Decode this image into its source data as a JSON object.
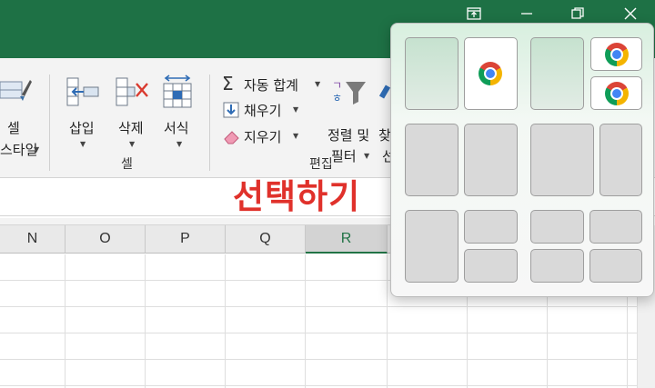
{
  "colors": {
    "title_bar": "#1e7145",
    "accent_green": "#217346",
    "overlay_red": "#e0312b"
  },
  "window_controls": {
    "icons": [
      "restore-ribbon-icon",
      "minimize-icon",
      "maximize-icon",
      "close-icon"
    ]
  },
  "ribbon": {
    "styles_group": {
      "button_label_top": "셀",
      "button_label_bottom": "스타일"
    },
    "cells_group": {
      "label": "셀",
      "buttons": [
        {
          "label": "삽입",
          "icon": "insert-cells-icon"
        },
        {
          "label": "삭제",
          "icon": "delete-cells-icon"
        },
        {
          "label": "서식",
          "icon": "format-cells-icon"
        }
      ]
    },
    "editing_group": {
      "label": "편집",
      "autosum": "자동 합계",
      "fill": "채우기",
      "clear": "지우기",
      "sort_filter_top": "정렬 및",
      "sort_filter_bottom": "필터",
      "find_top": "찾",
      "find_bottom": "선"
    }
  },
  "overlay_text": "선택하기",
  "columns": {
    "headers": [
      "N",
      "O",
      "P",
      "Q",
      "R"
    ],
    "selected": "R"
  },
  "snap_layouts": {
    "app_icon": "chrome-icon",
    "highlighted_zone": "layout-1-right-half"
  }
}
